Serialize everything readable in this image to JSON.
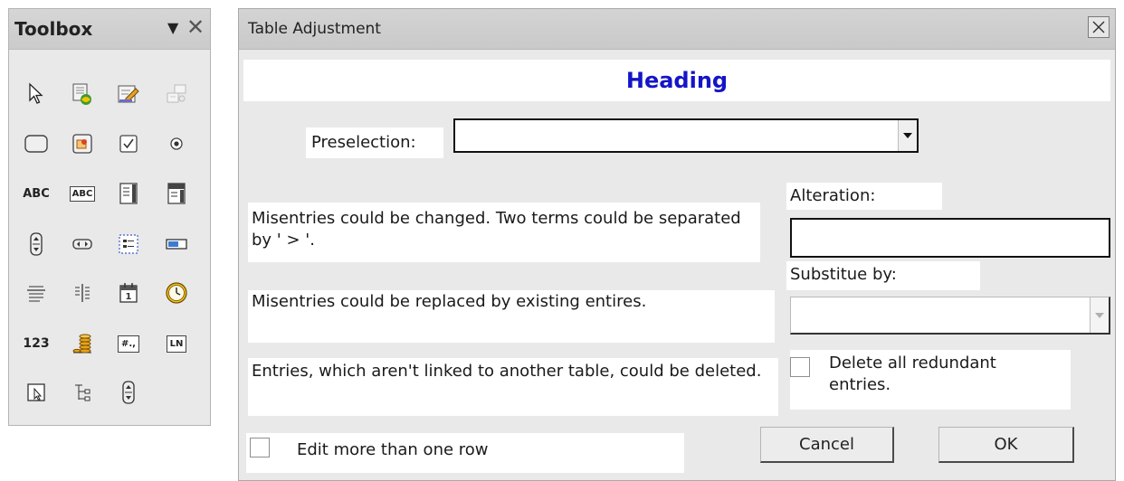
{
  "toolbox": {
    "title": "Toolbox",
    "dropdown_icon": "caret-down-icon",
    "close_icon": "close-icon",
    "items": [
      {
        "name": "select-pointer-icon"
      },
      {
        "name": "form-design-icon"
      },
      {
        "name": "form-edit-icon"
      },
      {
        "name": "tab-order-icon"
      },
      {
        "name": "push-button-icon"
      },
      {
        "name": "image-button-icon"
      },
      {
        "name": "checkbox-icon"
      },
      {
        "name": "option-button-icon"
      },
      {
        "name": "label-field-icon",
        "text": "ABC"
      },
      {
        "name": "text-box-icon",
        "text": "ABC"
      },
      {
        "name": "list-box-icon"
      },
      {
        "name": "combo-box-icon"
      },
      {
        "name": "scroll-bar-icon"
      },
      {
        "name": "spin-button-icon"
      },
      {
        "name": "group-box-icon"
      },
      {
        "name": "progress-bar-icon"
      },
      {
        "name": "horizontal-line-icon"
      },
      {
        "name": "vertical-line-icon"
      },
      {
        "name": "date-field-icon"
      },
      {
        "name": "time-field-icon"
      },
      {
        "name": "numeric-field-icon",
        "text": "123"
      },
      {
        "name": "currency-field-icon"
      },
      {
        "name": "formatted-field-icon",
        "text": "#.,"
      },
      {
        "name": "pattern-field-icon",
        "text": "LN"
      },
      {
        "name": "file-selection-icon"
      },
      {
        "name": "tree-control-icon"
      },
      {
        "name": "spin-control-icon"
      }
    ]
  },
  "dialog": {
    "title": "Table Adjustment",
    "heading": "Heading",
    "preselection_label": "Preselection:",
    "preselection_value": "",
    "misentries_changed_text": "Misentries could be changed. Two terms could be separated by ' > '.",
    "alteration_label": "Alteration:",
    "alteration_value": "",
    "substitute_label": "Substitue by:",
    "substitute_value": "",
    "misentries_replaced_text": "Misentries could be replaced by existing entires.",
    "entries_not_linked_text": "Entries, which aren't linked to another table, could be deleted.",
    "delete_redundant_label": "Delete all redundant entries.",
    "delete_redundant_checked": false,
    "edit_more_label": "Edit more than one row",
    "edit_more_checked": false,
    "cancel_label": "Cancel",
    "ok_label": "OK"
  },
  "colors": {
    "heading": "#1414c8",
    "dialog_bg": "#e9e9e9",
    "titlebar_bg": "#cfcfcf"
  }
}
